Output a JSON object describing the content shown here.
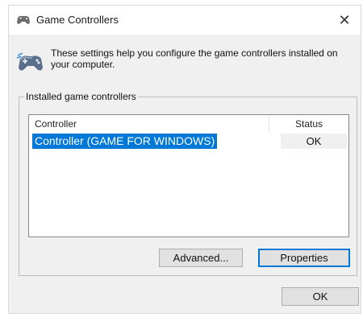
{
  "window": {
    "title": "Game Controllers",
    "close_label": "✕"
  },
  "header": {
    "description": "These settings help you configure the game controllers installed on your computer."
  },
  "group": {
    "label": "Installed game controllers",
    "columns": [
      "Controller",
      "Status"
    ],
    "rows": [
      {
        "controller": "Controller (GAME FOR WINDOWS)",
        "status": "OK",
        "selected": true
      }
    ]
  },
  "buttons": {
    "advanced": "Advanced...",
    "properties": "Properties",
    "ok": "OK"
  },
  "colors": {
    "selection": "#0078d7",
    "dialog_bg": "#f0f0f0"
  }
}
